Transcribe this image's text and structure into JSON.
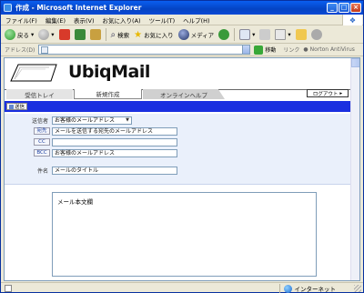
{
  "window": {
    "title": "作成 - Microsoft Internet Explorer"
  },
  "menu": [
    "ファイル(F)",
    "編集(E)",
    "表示(V)",
    "お気に入り(A)",
    "ツール(T)",
    "ヘルプ(H)"
  ],
  "toolbar": {
    "back_label": "戻る",
    "search_label": "検索",
    "favorites_label": "お気に入り",
    "media_label": "メディア"
  },
  "address": {
    "label": "アドレス(D)",
    "value": "",
    "go_label": "移動",
    "links_label": "リンク",
    "links_item": "Norton AntiVirus"
  },
  "app": {
    "brand": "UbiqMail",
    "tabs": [
      "受信トレイ",
      "新規作成",
      "オンラインヘルプ"
    ],
    "logout_label": "ログアウト",
    "send_label": "送信"
  },
  "form": {
    "from_label": "送信者",
    "from_value": "お客様のメールアドレス",
    "to_label": "宛先",
    "to_value": "メールを送信する宛先のメールアドレス",
    "cc_label": "CC",
    "cc_value": "",
    "bcc_label": "BCC",
    "bcc_value": "お客様のメールアドレス",
    "subject_label": "件名",
    "subject_value": "メールのタイトル",
    "body_value": "メール本文欄"
  },
  "status": {
    "zone": "インターネット"
  },
  "colors": {
    "accent_bar": "#1a2fe0",
    "form_bg": "#eaf0fb",
    "title_bar": "#0a5ef0"
  }
}
